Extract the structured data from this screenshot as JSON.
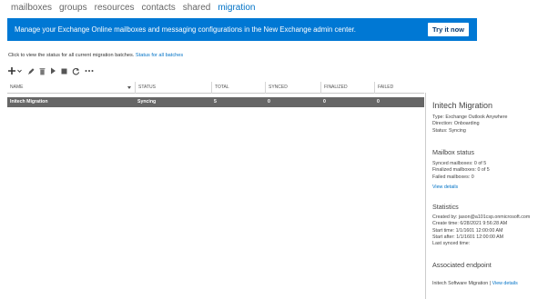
{
  "nav": {
    "items": [
      "mailboxes",
      "groups",
      "resources",
      "contacts",
      "shared",
      "migration"
    ],
    "active": "migration"
  },
  "banner": {
    "text": "Manage your Exchange Online mailboxes and messaging configurations in the New Exchange admin center.",
    "button": "Try it now",
    "color": "#0078d4"
  },
  "info": {
    "text": "Click to view the status for all current migration batches.",
    "link": "Status for all batches"
  },
  "toolbar": {
    "icons": [
      "add-icon",
      "edit-icon",
      "delete-icon",
      "start-icon",
      "stop-icon",
      "refresh-icon",
      "more-icon"
    ]
  },
  "table": {
    "columns": [
      "NAME",
      "STATUS",
      "TOTAL",
      "SYNCED",
      "FINALIZED",
      "FAILED"
    ],
    "rows": [
      {
        "name": "Initech Migration",
        "status": "Syncing",
        "total": "5",
        "synced": "0",
        "finalized": "0",
        "failed": "0"
      }
    ]
  },
  "details": {
    "title": "Initech Migration",
    "summary": [
      "Type: Exchange Outlook Anywhere",
      "Direction: Onboarding",
      "Status: Syncing"
    ],
    "mailbox_status": {
      "heading": "Mailbox status",
      "lines": [
        "Synced mailboxes: 0 of 5",
        "Finalized mailboxes: 0 of 5",
        "Failed mailboxes: 0"
      ],
      "link": "View details"
    },
    "statistics": {
      "heading": "Statistics",
      "lines": [
        "Created by: jason@a101csp.onmicrosoft.com",
        "Create time: 6/28/2021 9:56:28 AM",
        "Start time: 1/1/1601 12:00:00 AM",
        "Start after: 1/1/1601 12:00:00 AM",
        "Last synced time:"
      ]
    },
    "endpoint": {
      "heading": "Associated endpoint",
      "name": "Initech Software Migration",
      "separator": " | ",
      "link": "View details"
    }
  }
}
